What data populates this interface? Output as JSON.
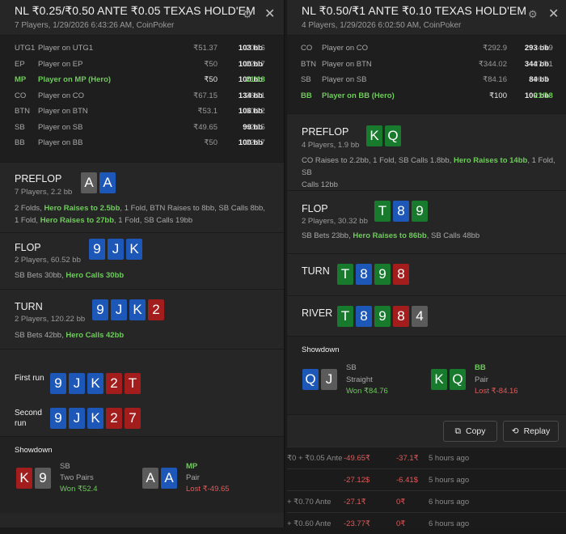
{
  "left": {
    "title": "NL ₹0.25/₹0.50 ANTE ₹0.05 TEXAS HOLD'EM",
    "subtitle": "7 Players, 1/29/2026 6:43:26 AM, CoinPoker",
    "players": [
      {
        "pos": "UTG1",
        "name": "Player on UTG1",
        "stack": "₹51.37",
        "bb": "103 bb",
        "vpip": "20/16",
        "hero": false
      },
      {
        "pos": "EP",
        "name": "Player on EP",
        "stack": "₹50",
        "bb": "100 bb",
        "vpip": "22/17",
        "hero": false
      },
      {
        "pos": "MP",
        "name": "Player on MP (Hero)",
        "stack": "₹50",
        "bb": "100 bb",
        "vpip": "21/18",
        "hero": true
      },
      {
        "pos": "CO",
        "name": "Player on CO",
        "stack": "₹67.15",
        "bb": "134 bb",
        "vpip": "26/21",
        "hero": false
      },
      {
        "pos": "BTN",
        "name": "Player on BTN",
        "stack": "₹53.1",
        "bb": "106 bb",
        "vpip": "30/22",
        "hero": false
      },
      {
        "pos": "SB",
        "name": "Player on SB",
        "stack": "₹49.65",
        "bb": "99 bb",
        "vpip": "42/15",
        "hero": false
      },
      {
        "pos": "BB",
        "name": "Player on BB",
        "stack": "₹50",
        "bb": "100 bb",
        "vpip": "22/17",
        "hero": false
      }
    ],
    "preflop": {
      "name": "PREFLOP",
      "info": "7 Players, 2.2 bb",
      "cards": [
        {
          "r": "A",
          "c": "#5b5b5b"
        },
        {
          "r": "A",
          "c": "#1d57b8"
        }
      ],
      "a1": "2 Folds, ",
      "b1": "Hero Raises to 2.5bb",
      "a2": ", 1 Fold, BTN Raises to 8bb, SB Calls 8bb,",
      "a3": "1 Fold, ",
      "b2": "Hero Raises to 27bb",
      "a4": ", 1 Fold, SB Calls 19bb"
    },
    "flop": {
      "name": "FLOP",
      "info": "2 Players, 60.52 bb",
      "cards": [
        {
          "r": "9",
          "c": "#1d57b8"
        },
        {
          "r": "J",
          "c": "#1d57b8"
        },
        {
          "r": "K",
          "c": "#1d57b8"
        }
      ],
      "a1": "SB Bets 30bb, ",
      "b1": "Hero Calls 30bb"
    },
    "turn": {
      "name": "TURN",
      "info": "2 Players, 120.22 bb",
      "cards": [
        {
          "r": "9",
          "c": "#1d57b8"
        },
        {
          "r": "J",
          "c": "#1d57b8"
        },
        {
          "r": "K",
          "c": "#1d57b8"
        },
        {
          "r": "2",
          "c": "#a31d1d"
        }
      ],
      "a1": "SB Bets 42bb, ",
      "b1": "Hero Calls 42bb"
    },
    "run1": {
      "label": "First run",
      "cards": [
        {
          "r": "9",
          "c": "#1d57b8"
        },
        {
          "r": "J",
          "c": "#1d57b8"
        },
        {
          "r": "K",
          "c": "#1d57b8"
        },
        {
          "r": "2",
          "c": "#a31d1d"
        },
        {
          "r": "T",
          "c": "#a31d1d"
        }
      ]
    },
    "run2": {
      "label": "Second run",
      "cards": [
        {
          "r": "9",
          "c": "#1d57b8"
        },
        {
          "r": "J",
          "c": "#1d57b8"
        },
        {
          "r": "K",
          "c": "#1d57b8"
        },
        {
          "r": "2",
          "c": "#a31d1d"
        },
        {
          "r": "7",
          "c": "#a31d1d"
        }
      ]
    },
    "showdown": {
      "label": "Showdown",
      "p1": {
        "cards": [
          {
            "r": "K",
            "c": "#a31d1d"
          },
          {
            "r": "9",
            "c": "#5b5b5b"
          }
        ],
        "pos": "SB",
        "hand": "Two Pairs",
        "result": "Won ₹52.4"
      },
      "p2": {
        "cards": [
          {
            "r": "A",
            "c": "#5b5b5b"
          },
          {
            "r": "A",
            "c": "#1d57b8"
          }
        ],
        "pos": "MP",
        "hand": "Pair",
        "result": "Lost ₹-49.65"
      }
    }
  },
  "right": {
    "title": "NL ₹0.50/₹1 ANTE ₹0.10 TEXAS HOLD'EM",
    "subtitle": "4 Players, 1/29/2026 6:02:50 AM, CoinPoker",
    "players": [
      {
        "pos": "CO",
        "name": "Player on CO",
        "stack": "₹292.9",
        "bb": "293 bb",
        "vpip": "24/19",
        "hero": false
      },
      {
        "pos": "BTN",
        "name": "Player on BTN",
        "stack": "₹344.02",
        "bb": "344 bb",
        "vpip": "27/21",
        "hero": false
      },
      {
        "pos": "SB",
        "name": "Player on SB",
        "stack": "₹84.16",
        "bb": "84 bb",
        "vpip": "96/4",
        "hero": false
      },
      {
        "pos": "BB",
        "name": "Player on BB (Hero)",
        "stack": "₹100",
        "bb": "100 bb",
        "vpip": "21/18",
        "hero": true
      }
    ],
    "preflop": {
      "name": "PREFLOP",
      "info": "4 Players, 1.9 bb",
      "cards": [
        {
          "r": "K",
          "c": "#177a2d"
        },
        {
          "r": "Q",
          "c": "#177a2d"
        }
      ],
      "a1": "CO Raises to 2.2bb, 1 Fold, SB Calls 1.8bb, ",
      "b1": "Hero Raises to 14bb",
      ", 1 Fold, SB": "",
      "a2": ", 1 Fold, SB",
      "a3": "Calls 12bb"
    },
    "flop": {
      "name": "FLOP",
      "info": "2 Players, 30.32 bb",
      "cards": [
        {
          "r": "T",
          "c": "#177a2d"
        },
        {
          "r": "8",
          "c": "#1d57b8"
        },
        {
          "r": "9",
          "c": "#177a2d"
        }
      ],
      "a1": "SB Bets 23bb, ",
      "b1": "Hero Raises to 86bb",
      "a2": ", SB Calls 48bb"
    },
    "turn": {
      "name": "TURN",
      "cards": [
        {
          "r": "T",
          "c": "#177a2d"
        },
        {
          "r": "8",
          "c": "#1d57b8"
        },
        {
          "r": "9",
          "c": "#177a2d"
        },
        {
          "r": "8",
          "c": "#a31d1d"
        }
      ]
    },
    "river": {
      "name": "RIVER",
      "cards": [
        {
          "r": "T",
          "c": "#177a2d"
        },
        {
          "r": "8",
          "c": "#1d57b8"
        },
        {
          "r": "9",
          "c": "#177a2d"
        },
        {
          "r": "8",
          "c": "#a31d1d"
        },
        {
          "r": "4",
          "c": "#5b5b5b"
        }
      ]
    },
    "showdown": {
      "label": "Showdown",
      "p1": {
        "cards": [
          {
            "r": "Q",
            "c": "#1d57b8"
          },
          {
            "r": "J",
            "c": "#5b5b5b"
          }
        ],
        "pos": "SB",
        "hand": "Straight",
        "result": "Won ₹84.76"
      },
      "p2": {
        "cards": [
          {
            "r": "K",
            "c": "#177a2d"
          },
          {
            "r": "Q",
            "c": "#177a2d"
          }
        ],
        "pos": "BB",
        "hand": "Pair",
        "result": "Lost ₹-84.16"
      }
    },
    "copy_label": "Copy",
    "replay_label": "Replay"
  },
  "background_rows": [
    {
      "stakes": "₹0 + ₹0.05 Ante",
      "pnl": "-49.65₹",
      "ev": "-37.1₹",
      "time": "5 hours ago"
    },
    {
      "stakes": "",
      "pnl": "-27.12$",
      "ev": "-6.41$",
      "time": "5 hours ago"
    },
    {
      "stakes": "+ ₹0.70 Ante",
      "pnl": "-27.1₹",
      "ev": "0₹",
      "time": "6 hours ago"
    },
    {
      "stakes": "+ ₹0.60 Ante",
      "pnl": "-23.77₹",
      "ev": "0₹",
      "time": "6 hours ago"
    }
  ]
}
